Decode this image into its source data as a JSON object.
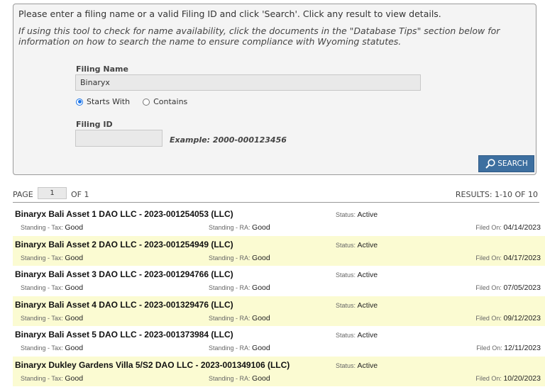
{
  "search": {
    "instruction": "Please enter a filing name or a valid Filing ID and click 'Search'. Click any result to view details.",
    "tip": "If using this tool to check for name availability, click the documents in the \"Database Tips\" section below for information on how to search the name to ensure compliance with Wyoming statutes.",
    "filing_name_label": "Filing Name",
    "filing_name_value": "Binaryx",
    "radio_starts_with": "Starts With",
    "radio_contains": "Contains",
    "selected_mode": "Starts With",
    "filing_id_label": "Filing ID",
    "filing_id_value": "",
    "example": "Example: 2000-000123456",
    "button_label": "SEARCH"
  },
  "pager": {
    "page_label": "PAGE",
    "page_value": "1",
    "of_label": "OF 1",
    "results": "RESULTS: 1-10 OF 10"
  },
  "labels": {
    "status": "Status:",
    "standing_tax": "Standing - Tax:",
    "standing_ra": "Standing - RA:",
    "filed_on": "Filed On:"
  },
  "results": [
    {
      "title": "Binaryx Bali Asset 1 DAO LLC - 2023-001254053 (LLC)",
      "status": "Active",
      "tax": "Good",
      "ra": "Good",
      "filed": "04/14/2023"
    },
    {
      "title": "Binaryx Bali Asset 2 DAO LLC - 2023-001254949 (LLC)",
      "status": "Active",
      "tax": "Good",
      "ra": "Good",
      "filed": "04/17/2023"
    },
    {
      "title": "Binaryx Bali Asset 3 DAO LLC - 2023-001294766 (LLC)",
      "status": "Active",
      "tax": "Good",
      "ra": "Good",
      "filed": "07/05/2023"
    },
    {
      "title": "Binaryx Bali Asset 4 DAO LLC - 2023-001329476 (LLC)",
      "status": "Active",
      "tax": "Good",
      "ra": "Good",
      "filed": "09/12/2023"
    },
    {
      "title": "Binaryx Bali Asset 5 DAO LLC - 2023-001373984 (LLC)",
      "status": "Active",
      "tax": "Good",
      "ra": "Good",
      "filed": "12/11/2023"
    },
    {
      "title": "Binaryx Dukley Gardens Villa 5/S2 DAO LLC - 2023-001349106 (LLC)",
      "status": "Active",
      "tax": "Good",
      "ra": "Good",
      "filed": "10/20/2023"
    }
  ],
  "colors": {
    "alt_row": "#fbfbd2",
    "search_button": "#3d6fa0",
    "radio_accent": "#1a73e8"
  },
  "icons": {
    "search_button": "magnifier-icon"
  }
}
